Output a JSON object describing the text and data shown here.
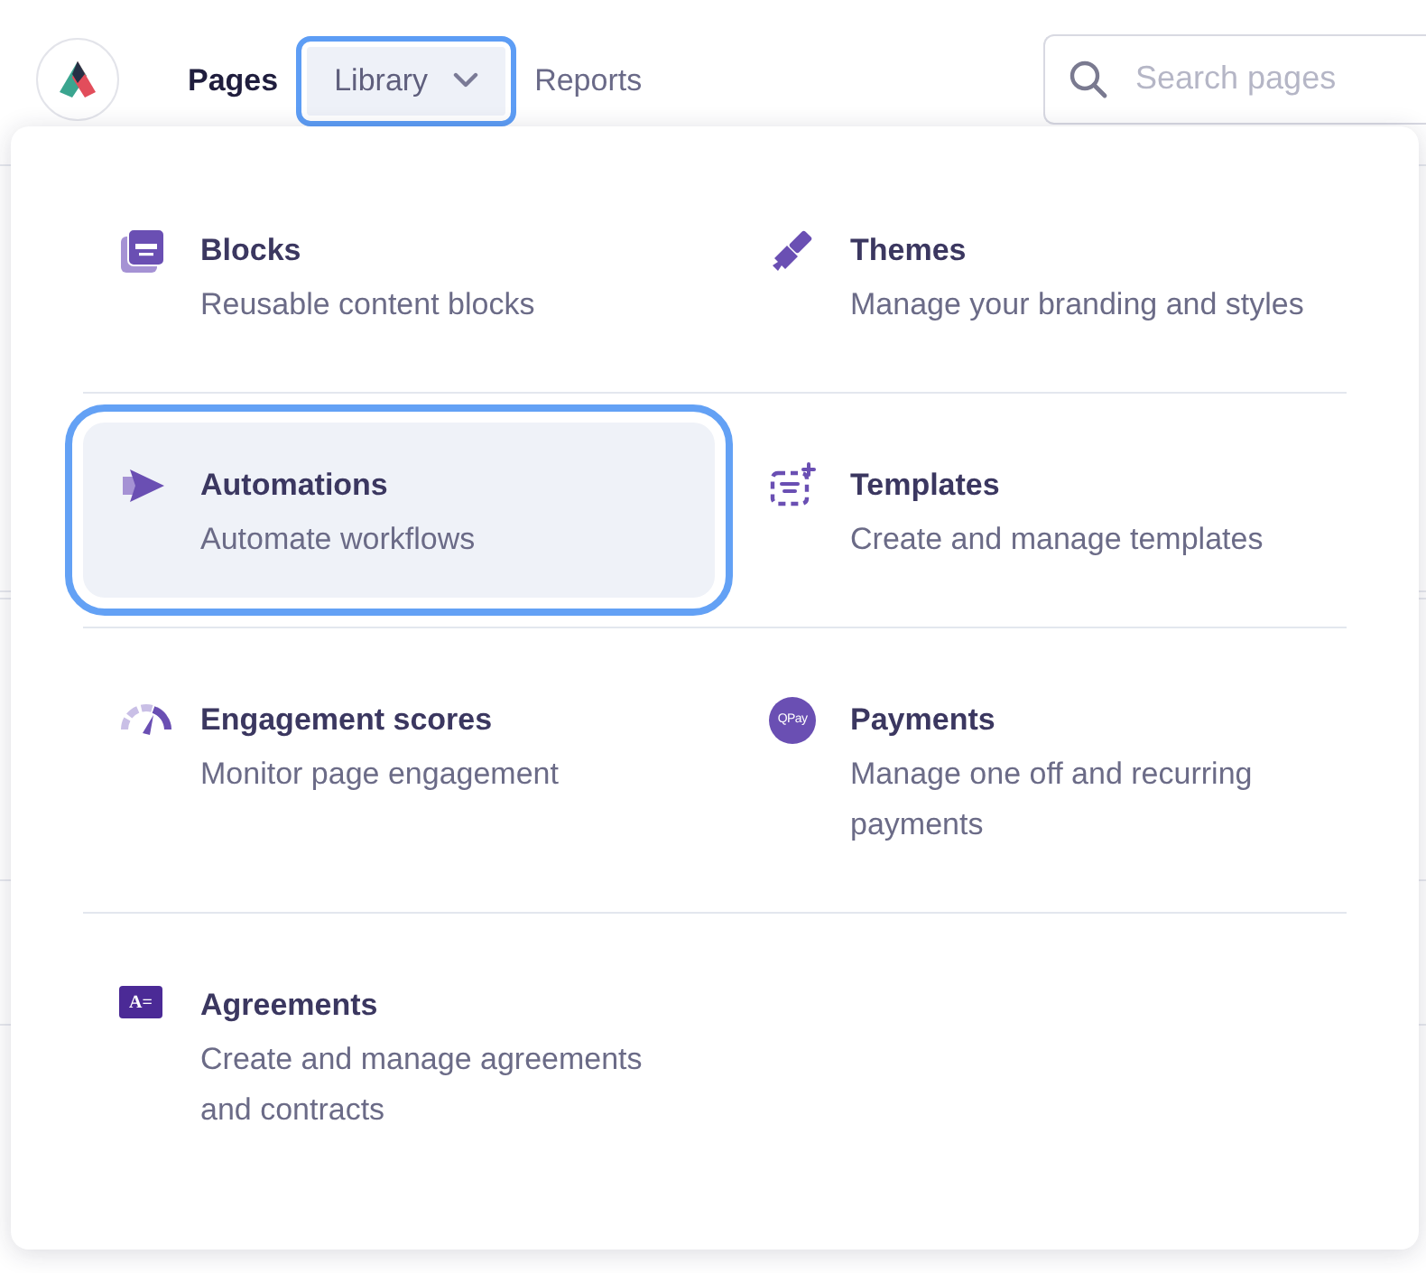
{
  "nav": {
    "items": [
      {
        "label": "Pages",
        "kind": "link",
        "selected": true
      },
      {
        "label": "Library",
        "kind": "dropdown",
        "selected": false,
        "expanded": true
      },
      {
        "label": "Reports",
        "kind": "link",
        "selected": false
      }
    ]
  },
  "search": {
    "placeholder": "Search pages"
  },
  "menu": {
    "rows": [
      [
        {
          "title": "Blocks",
          "description": "Reusable content blocks",
          "kind": "blocks",
          "selected": false
        },
        {
          "title": "Themes",
          "description": "Manage your branding and styles",
          "kind": "brush",
          "selected": false
        }
      ],
      [
        {
          "title": "Automations",
          "description": "Automate workflows",
          "kind": "play",
          "selected": true
        },
        {
          "title": "Templates",
          "description": "Create and manage templates",
          "kind": "template",
          "selected": false
        }
      ],
      [
        {
          "title": "Engagement scores",
          "description": "Monitor page engagement",
          "kind": "gauge",
          "selected": false
        },
        {
          "title": "Payments",
          "description": "Manage one off and recurring payments",
          "kind": "badge",
          "icon_label": "QPay",
          "selected": false
        }
      ],
      [
        {
          "title": "Agreements",
          "description": "Create and manage agreements and contracts",
          "kind": "doc",
          "icon_label": "A=",
          "selected": false
        }
      ]
    ]
  }
}
